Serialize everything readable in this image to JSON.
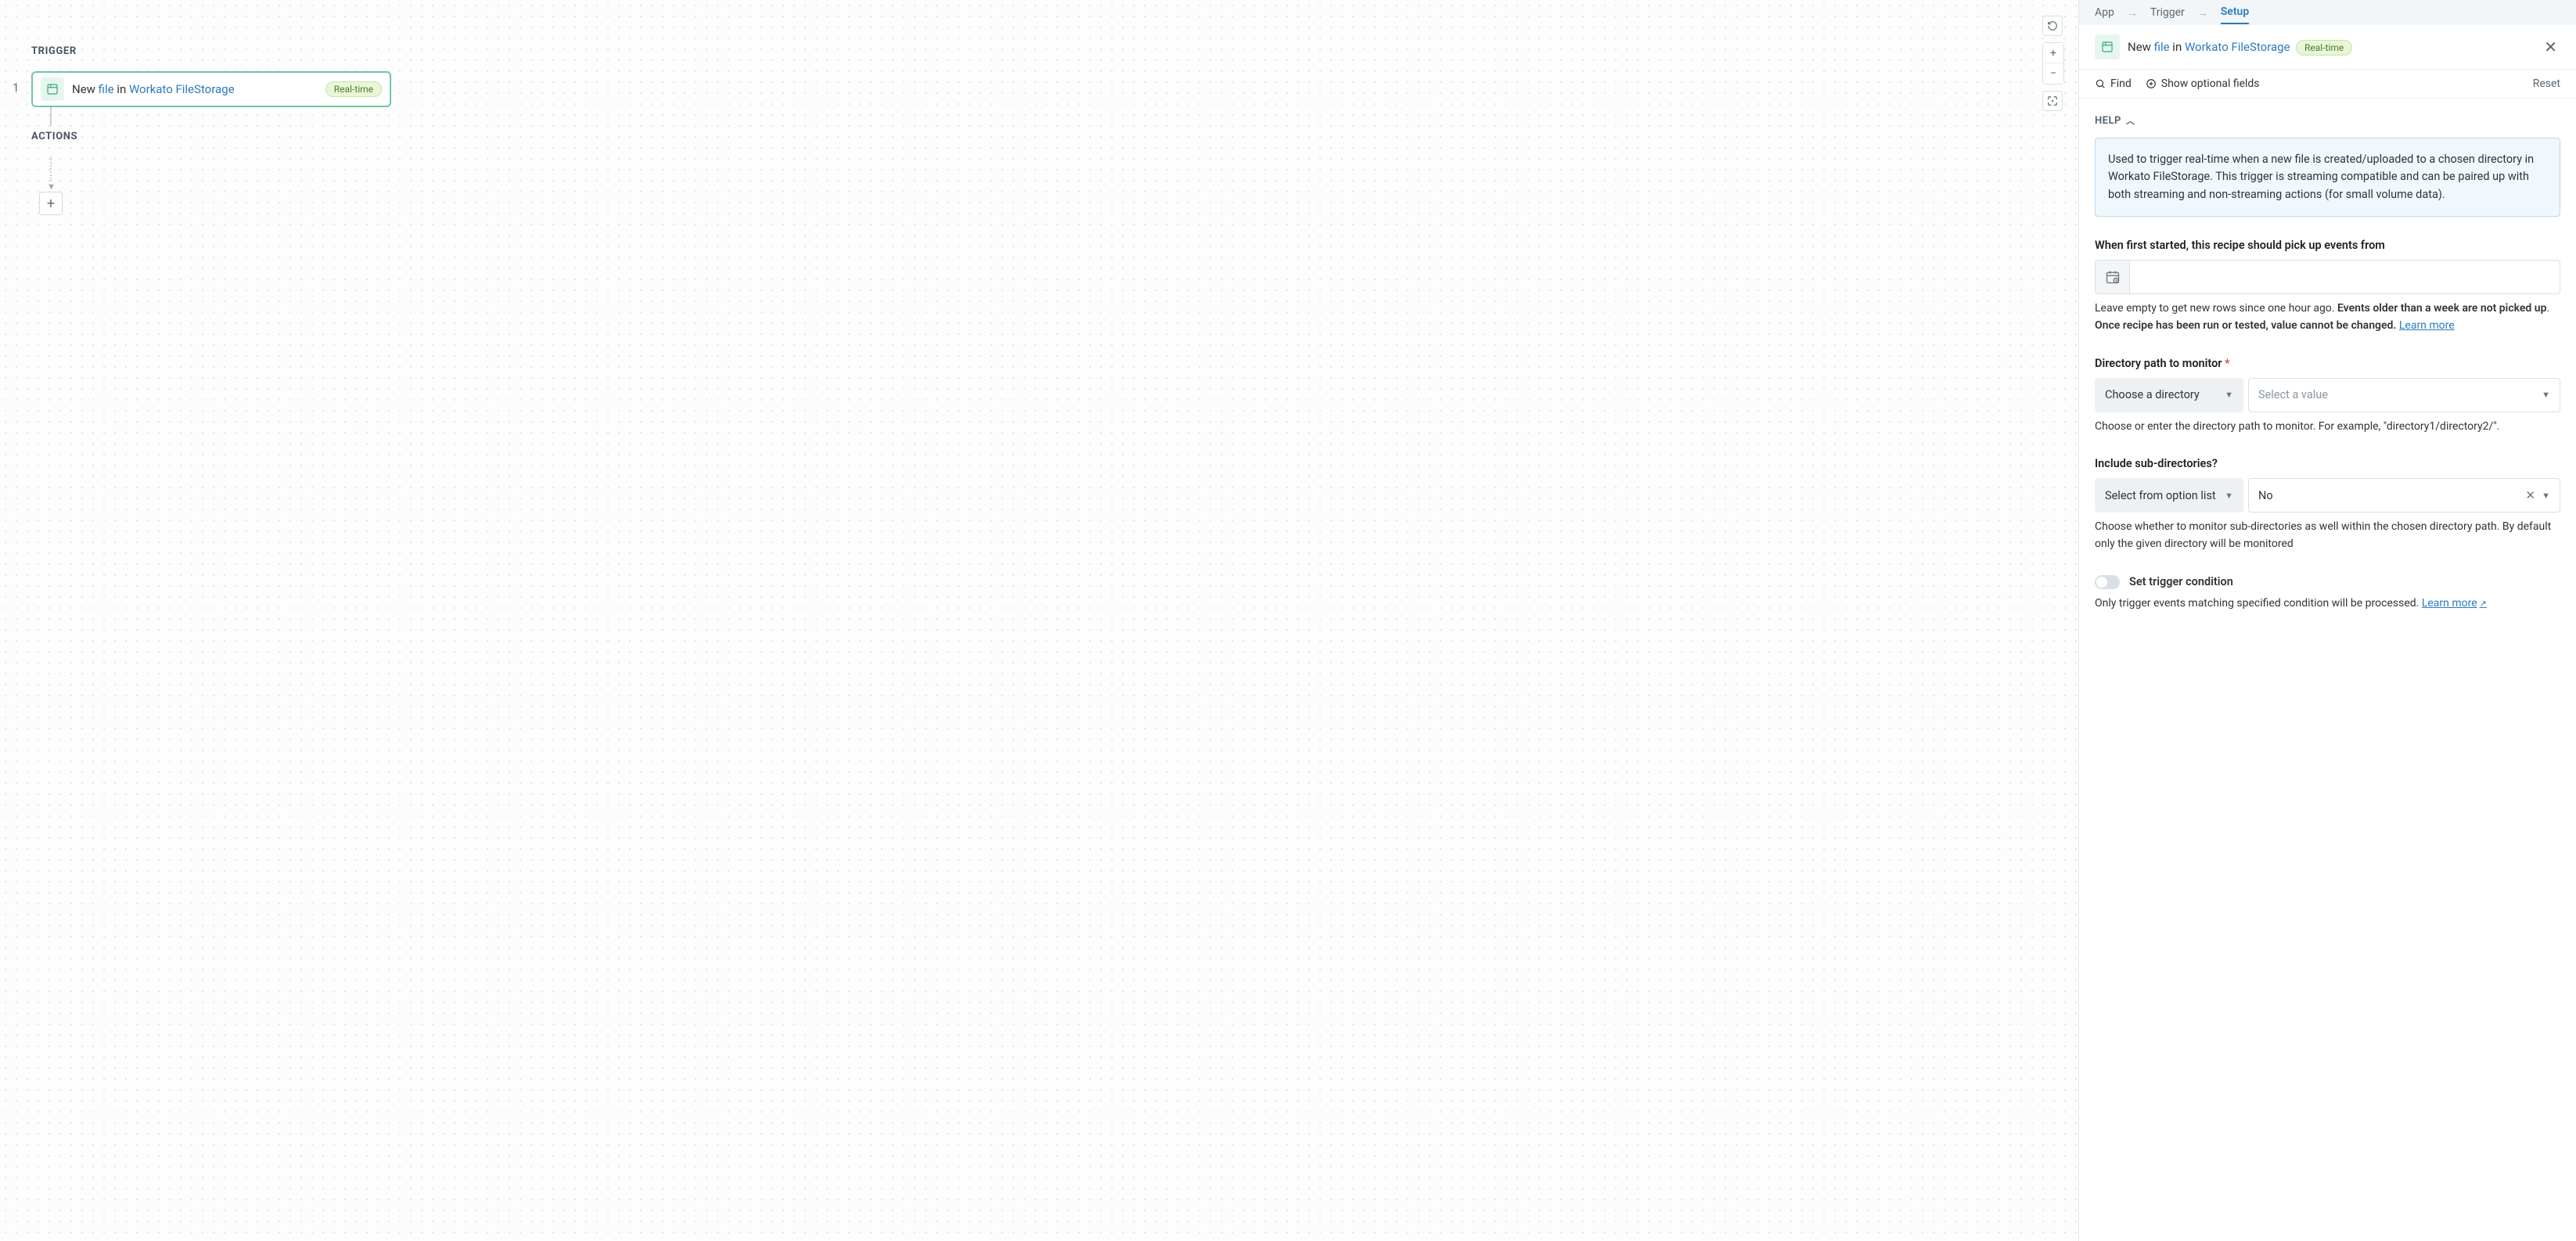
{
  "canvas": {
    "trigger_label": "TRIGGER",
    "actions_label": "ACTIONS",
    "step_number": "1",
    "trigger": {
      "prefix": "New ",
      "object": "file",
      "mid": " in ",
      "app": "Workato FileStorage",
      "badge": "Real-time"
    }
  },
  "tabs": {
    "app": "App",
    "trigger": "Trigger",
    "setup": "Setup"
  },
  "header": {
    "prefix": "New ",
    "object": "file",
    "mid": " in ",
    "app": "Workato FileStorage",
    "badge": "Real-time"
  },
  "toolbar": {
    "find": "Find",
    "show_optional": "Show optional fields",
    "reset": "Reset"
  },
  "help": {
    "title": "HELP",
    "text": "Used to trigger real-time when a new file is created/uploaded to a chosen directory in Workato FileStorage. This trigger is streaming compatible and can be paired up with both streaming and non-streaming actions (for small volume data)."
  },
  "fields": {
    "since": {
      "label": "When first started, this recipe should pick up events from",
      "hint_a": "Leave empty to get new rows since one hour ago. ",
      "hint_b": "Events older than a week are not picked up",
      "hint_c": ". ",
      "hint_d": "Once recipe has been run or tested, value cannot be changed. ",
      "learn_more": "Learn more"
    },
    "dir": {
      "label": "Directory path to monitor",
      "choose": "Choose a directory",
      "select_placeholder": "Select a value",
      "hint": "Choose or enter the directory path to monitor. For example, \"directory1/directory2/\"."
    },
    "subdir": {
      "label": "Include sub-directories?",
      "choose": "Select from option list",
      "value": "No",
      "hint": "Choose whether to monitor sub-directories as well within the chosen directory path. By default only the given directory will be monitored"
    },
    "condition": {
      "label": "Set trigger condition",
      "hint": "Only trigger events matching specified condition will be processed. ",
      "learn_more": "Learn more"
    }
  }
}
